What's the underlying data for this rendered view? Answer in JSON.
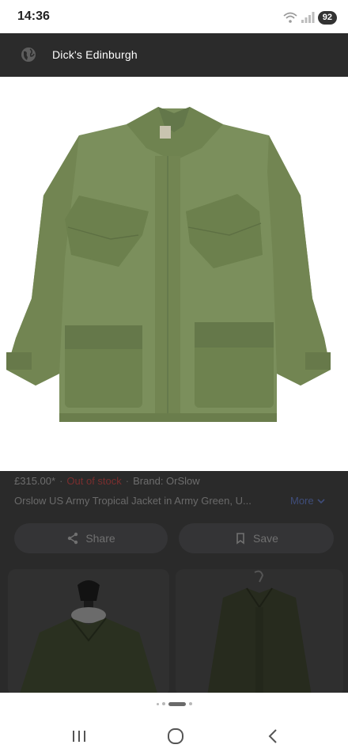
{
  "status_bar": {
    "time": "14:36",
    "battery": "92",
    "icons": [
      "wifi-icon",
      "signal-icon"
    ]
  },
  "header": {
    "title": "Dick's Edinburgh",
    "icon": "globe-icon"
  },
  "product": {
    "price": "£315.00*",
    "stock_status": "Out of stock",
    "brand": "Brand: OrSlow",
    "title": "Orslow US Army Tropical Jacket in Army Green, U...",
    "more_label": "More"
  },
  "actions": {
    "share_label": "Share",
    "save_label": "Save"
  },
  "colors": {
    "jacket_green": "#7b8f5c",
    "overlay_dark": "#2a2a2a",
    "header_dark": "#2b2b2b",
    "stock_red": "#7a2e2e",
    "more_blue": "#3f4d7a"
  },
  "navigation": {
    "icons": [
      "recent-apps-icon",
      "home-icon",
      "back-icon"
    ]
  }
}
